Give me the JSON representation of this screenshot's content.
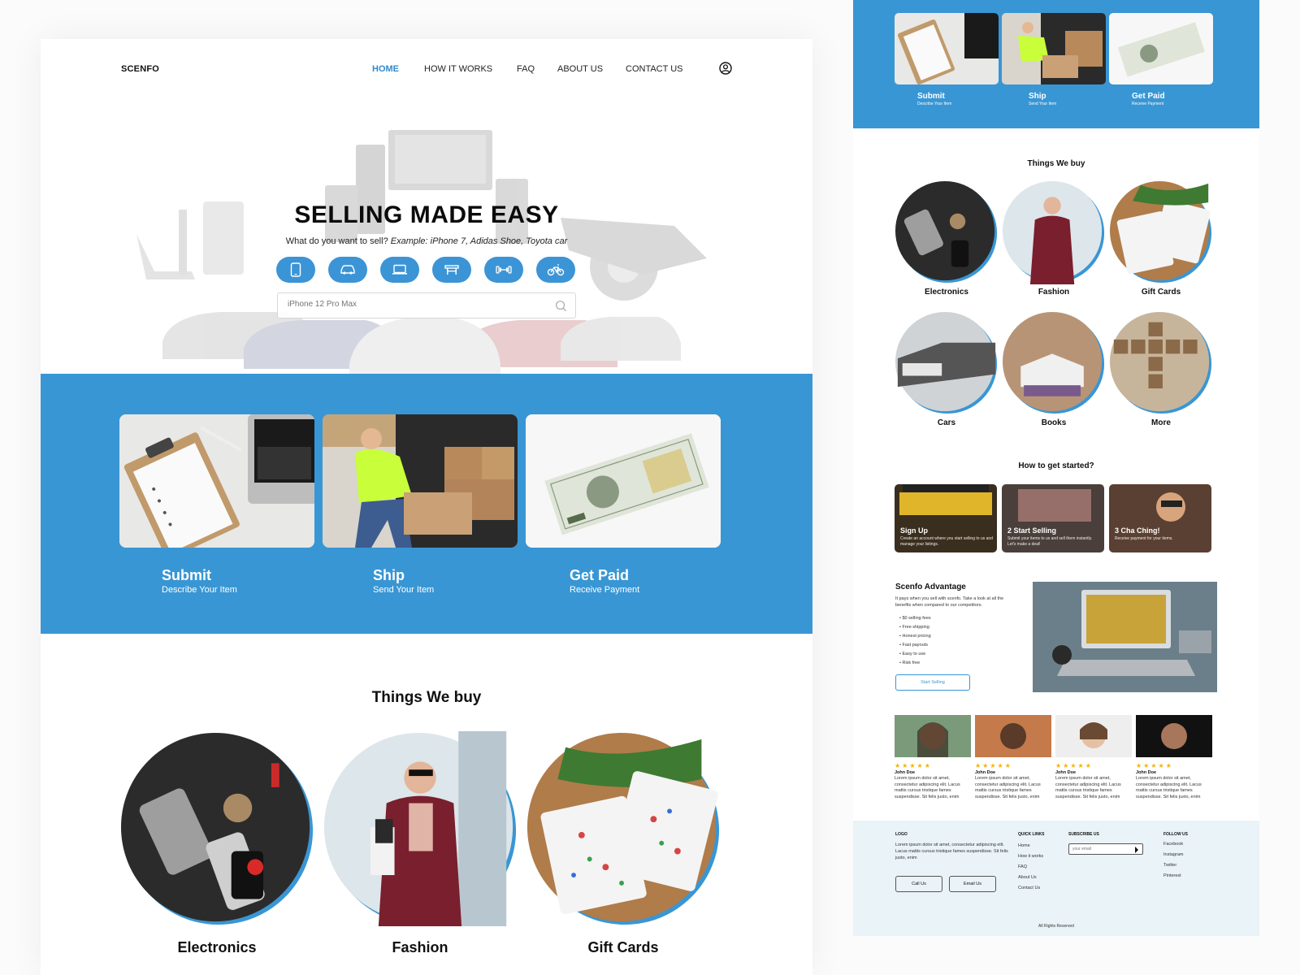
{
  "nav": {
    "logo": "SCENFO",
    "items": [
      "HOME",
      "HOW IT WORKS",
      "FAQ",
      "ABOUT US",
      "CONTACT US"
    ],
    "active": "HOME"
  },
  "hero": {
    "title": "SELLING MADE EASY",
    "subtitle_plain": "What do you want to sell? ",
    "subtitle_example": "Example: iPhone 7, Adidas Shoe, Toyota car",
    "categories": [
      "phone-icon",
      "car-icon",
      "laptop-icon",
      "furniture-icon",
      "fitness-icon",
      "bike-icon"
    ],
    "search_placeholder": "iPhone 12 Pro Max"
  },
  "steps": [
    {
      "title": "Submit",
      "subtitle": "Describe Your Item"
    },
    {
      "title": "Ship",
      "subtitle": "Send Your Item"
    },
    {
      "title": "Get Paid",
      "subtitle": "Receive Payment"
    }
  ],
  "things": {
    "title": "Things We buy",
    "items": [
      "Electronics",
      "Fashion",
      "Gift Cards",
      "Cars",
      "Books",
      "More"
    ]
  },
  "start": {
    "title": "How to get started?",
    "steps": [
      {
        "title": "Sign Up",
        "desc": "Create an account where you start selling to us and manage your listings."
      },
      {
        "title": "2 Start Selling",
        "desc": "Submit your items to us and sell them instantly. Let's make a deal!"
      },
      {
        "title": "3 Cha Ching!",
        "desc": "Receive payment for your items."
      }
    ]
  },
  "advantage": {
    "title": "Scenfo Advantage",
    "desc": "It pays when you sell with scenfo. Take a look at all the benefits when compared to our competitors.",
    "list": [
      "$0 selling fees",
      "Free shipping",
      "Honest pricing",
      "Fast payouts",
      "Easy to use",
      "Risk free"
    ],
    "button": "Start Selling"
  },
  "testimonials": [
    {
      "stars": "★★★★★",
      "name": "John Doe",
      "text": "Lorem ipsum dolor sit amet, consectetur adipiscing elit. Lacus mattis cursus tristique fames suspendisse. Sit felis justo, enim"
    },
    {
      "stars": "★★★★★",
      "name": "John Doe",
      "text": "Lorem ipsum dolor sit amet, consectetur adipiscing elit. Lacus mattis cursus tristique fames suspendisse. Sit felis justo, enim"
    },
    {
      "stars": "★★★★★",
      "name": "John Doe",
      "text": "Lorem ipsum dolor sit amet, consectetur adipiscing elit. Lacus mattis cursus tristique fames suspendisse. Sit felis justo, enim"
    },
    {
      "stars": "★★★★★",
      "name": "John Doe",
      "text": "Lorem ipsum dolor sit amet, consectetur adipiscing elit. Lacus mattis cursus tristique fames suspendisse. Sit felis justo, enim"
    }
  ],
  "footer": {
    "logo_heading": "LOGO",
    "about": "Lorem ipsum dolor sit amet, consectetur adipiscing elit. Lacus mattis cursus tristique fames suspendisse. Sit felis justo, enim",
    "call_btn": "Call Us",
    "email_btn": "Email Us",
    "quick_heading": "QUICK LINKS",
    "quick_links": [
      "Home",
      "How it works",
      "FAQ",
      "About Us",
      "Contact Us"
    ],
    "subscribe_heading": "SUBSCRIBE US",
    "subscribe_placeholder": "your email",
    "follow_heading": "FOLLOW US",
    "follow_links": [
      "Facebook",
      "Instagram",
      "Twitter",
      "Pinterest"
    ],
    "rights": "All Rights Reserved"
  },
  "colors": {
    "accent": "#3996d4",
    "nav_active": "#2e8bd0",
    "footer_bg": "#e9f3f8",
    "star": "#f5b400"
  }
}
